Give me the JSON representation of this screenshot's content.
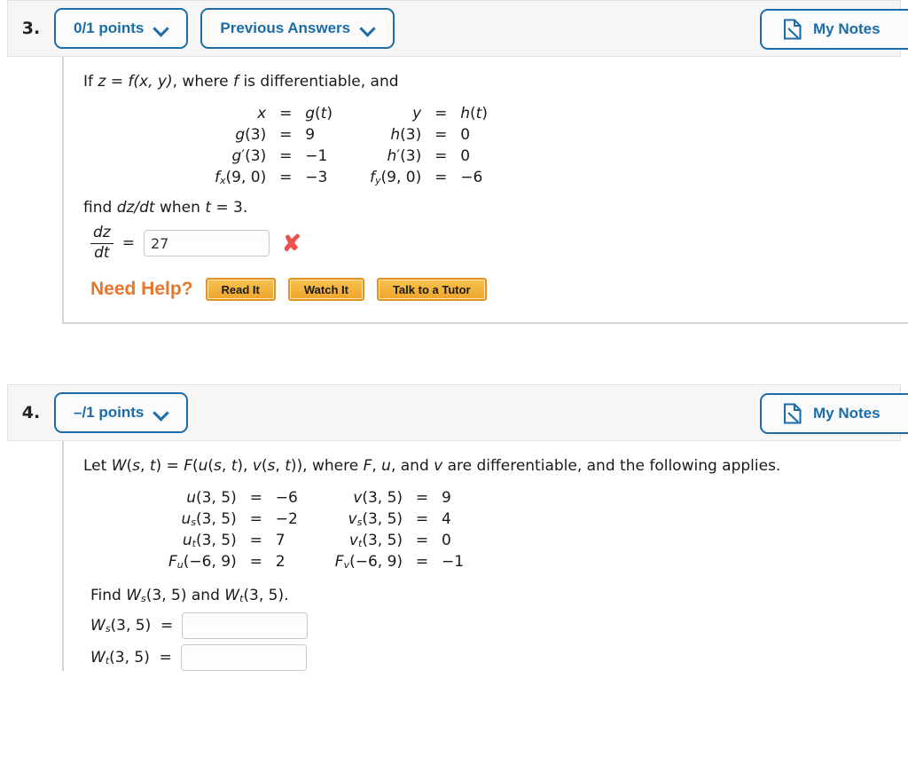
{
  "problems": [
    {
      "number": "3.",
      "points_label": "0/1 points",
      "previous_answers_label": "Previous Answers",
      "notes_label": "My Notes",
      "statement_prefix": "If ",
      "statement_z": "z",
      "statement_eq": " = ",
      "statement_f": "f",
      "statement_args": "(x, y)",
      "statement_mid": ", where ",
      "statement_f2": "f",
      "statement_tail": " is differentiable, and",
      "equations": [
        {
          "left": "x",
          "right_sym": "g(t)",
          "left2": "y",
          "right2": "h(t)"
        },
        {
          "left": "g(3)",
          "right_sym": "9",
          "left2": "h(3)",
          "right2": "0"
        },
        {
          "left": "g′(3)",
          "right_sym": "−1",
          "left2": "h′(3)",
          "right2": "0"
        },
        {
          "left": "fx(9, 0)",
          "right_sym": "−3",
          "left2": "fy(9, 0)",
          "right2": "−6"
        }
      ],
      "find_text_a": "find ",
      "find_text_b": "dz/dt",
      "find_text_c": " when ",
      "find_text_d": "t",
      "find_text_e": " = 3.",
      "answer_num": "dz",
      "answer_den": "dt",
      "answer_eq": "=",
      "answer_value": "27",
      "answer_placeholder": "",
      "answer_status": "✘",
      "need_help_label": "Need Help?",
      "help_buttons": [
        "Read It",
        "Watch It",
        "Talk to a Tutor"
      ]
    },
    {
      "number": "4.",
      "points_label": "–/1 points",
      "notes_label": "My Notes",
      "statement": "Let W(s, t) = F(u(s, t), v(s, t)), where F, u, and v are differentiable, and the following applies.",
      "equations": [
        {
          "left": "u(3, 5)",
          "right": "−6",
          "left2": "v(3, 5)",
          "right2": "9"
        },
        {
          "left": "us(3, 5)",
          "right": "−2",
          "left2": "vs(3, 5)",
          "right2": "4"
        },
        {
          "left": "ut(3, 5)",
          "right": "7",
          "left2": "vt(3, 5)",
          "right2": "0"
        },
        {
          "left": "Fu(−6, 9)",
          "right": "2",
          "left2": "Fv(−6, 9)",
          "right2": "−1"
        }
      ],
      "find_label": "Find Ws(3, 5) and Wt(3, 5).",
      "answers": [
        {
          "label": "Ws(3, 5)  =",
          "value": "",
          "placeholder": ""
        },
        {
          "label": "Wt(3, 5)  =",
          "value": "",
          "placeholder": ""
        }
      ]
    }
  ],
  "colors": {
    "accent_blue": "#1b6ca8",
    "header_band": "#f6f6f6",
    "help_orange": "#e8762a",
    "button_orange": "#efa52c",
    "error_red": "#f1504a",
    "divider": "#d4d4d4"
  }
}
